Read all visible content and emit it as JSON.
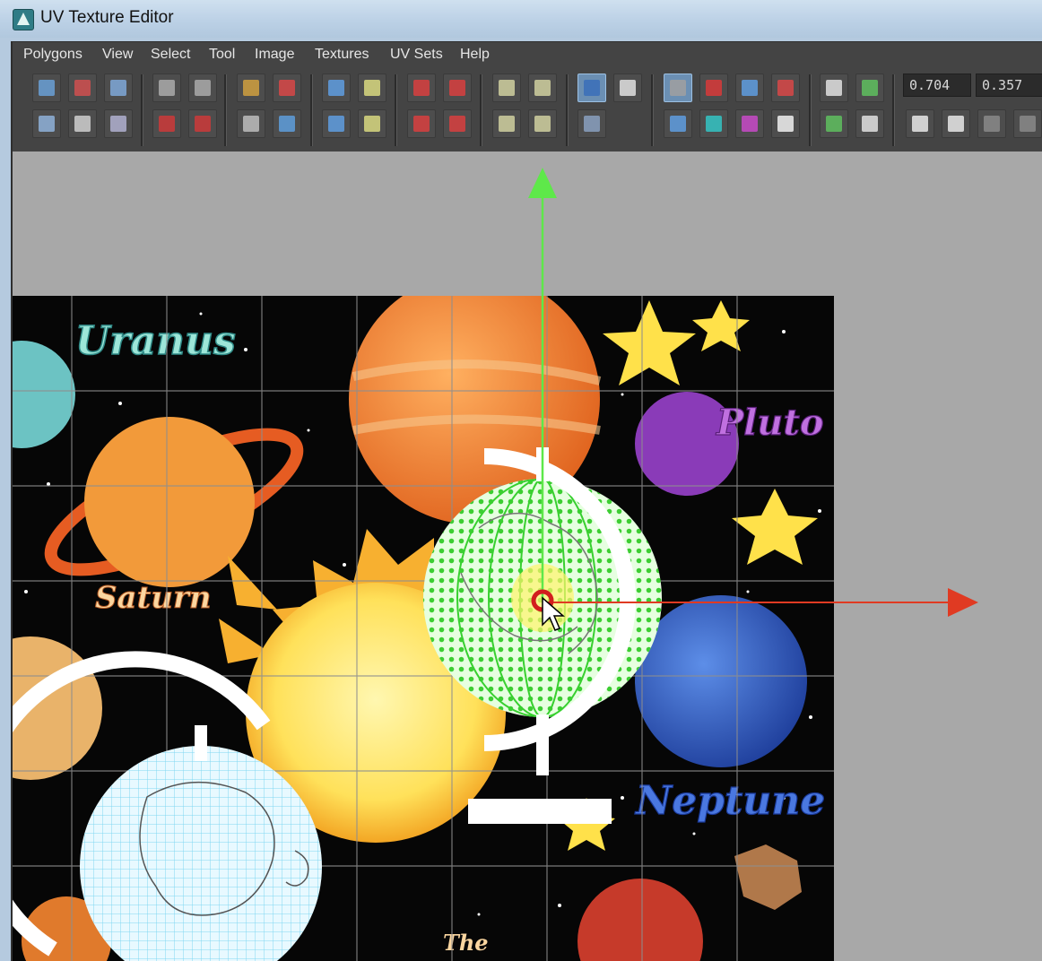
{
  "window": {
    "title": "UV Texture Editor"
  },
  "menubar": {
    "items": [
      "Polygons",
      "View",
      "Select",
      "Tool",
      "Image",
      "Textures",
      "UV Sets",
      "Help"
    ]
  },
  "toolbar": {
    "u_value": "0.704",
    "v_value": "0.357"
  },
  "texture": {
    "labels": {
      "uranus": "Uranus",
      "pluto": "Pluto",
      "saturn": "Saturn",
      "neptune": "Neptune",
      "the": "The"
    }
  },
  "colors": {
    "move_y_axis": "#5ee84a",
    "move_x_axis": "#e03a22",
    "uv_selected": "#6ae04a",
    "uv_unselected": "#7fd6f2"
  },
  "icons": [
    "app-icon",
    "move-icon",
    "checker-icon",
    "snap-magnet-icon",
    "psd-icon",
    "copy-icon",
    "paste-icon",
    "delete-icon"
  ]
}
